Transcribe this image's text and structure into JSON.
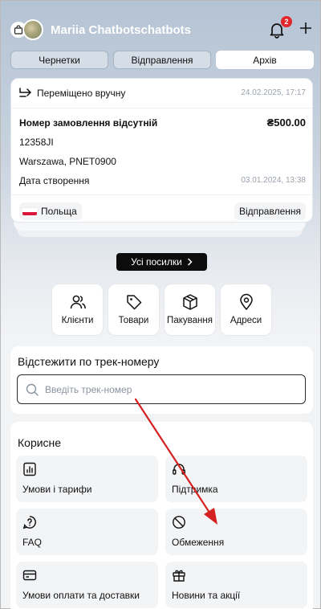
{
  "header": {
    "user_name": "Mariia Chatbotschatbots",
    "notification_count": "2"
  },
  "tabs": [
    {
      "label": "Чернетки"
    },
    {
      "label": "Відправлення"
    },
    {
      "label": "Архів"
    }
  ],
  "shipment_card": {
    "moved_text": "Переміщено вручну",
    "moved_date": "24.02.2025, 17:17",
    "order_label": "Номер замовлення відсутній",
    "price": "₴500.00",
    "order_number": "12358JI",
    "city_line": "Warszawa, PNET0900",
    "created_label": "Дата створення",
    "created_date": "03.01.2024, 13:38",
    "country": "Польща",
    "status": "Відправлення"
  },
  "all_parcels_button": "Усі посилки",
  "quick_actions": [
    {
      "label": "Клієнти",
      "icon": "users-icon"
    },
    {
      "label": "Товари",
      "icon": "tag-icon"
    },
    {
      "label": "Пакування",
      "icon": "box-icon"
    },
    {
      "label": "Адреси",
      "icon": "map-pin-icon"
    }
  ],
  "tracking": {
    "title": "Відстежити по трек-номеру",
    "placeholder": "Введіть трек-номер"
  },
  "useful": {
    "title": "Корисне",
    "items": [
      {
        "label": "Умови і тарифи",
        "icon": "chart-icon"
      },
      {
        "label": "Підтримка",
        "icon": "headset-icon"
      },
      {
        "label": "FAQ",
        "icon": "question-icon"
      },
      {
        "label": "Обмеження",
        "icon": "restriction-icon"
      },
      {
        "label": "Умови оплати та доставки",
        "icon": "card-icon"
      },
      {
        "label": "Новини та акції",
        "icon": "gift-icon"
      }
    ]
  },
  "colors": {
    "badge": "#e3262b",
    "annotation_arrow": "#d42020",
    "flag_top": "#ffffff",
    "flag_bottom": "#dc143c"
  }
}
